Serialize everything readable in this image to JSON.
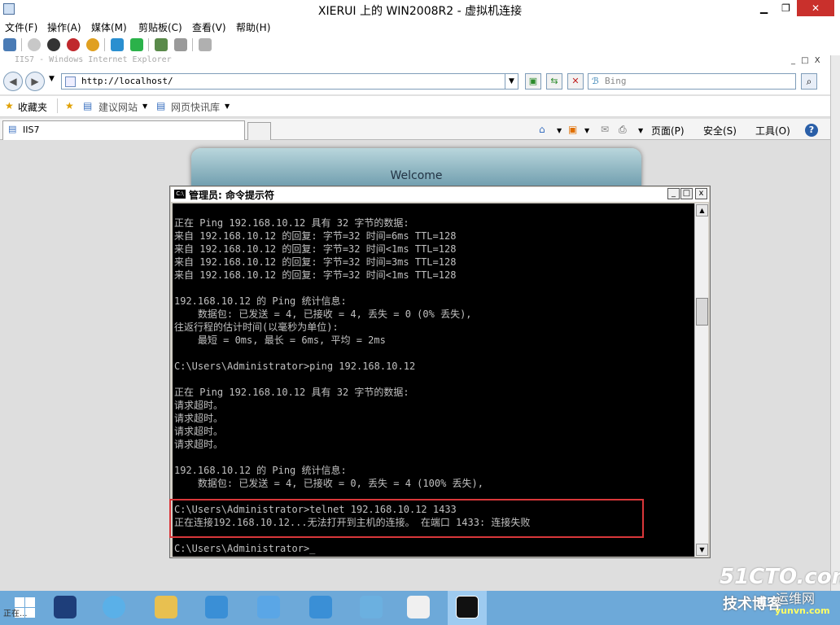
{
  "vm": {
    "title": "XIERUI 上的 WIN2008R2 - 虚拟机连接",
    "minimize": "▁",
    "maximize": "❐",
    "close": "✕",
    "menu": [
      "文件(F)",
      "操作(A)",
      "媒体(M)",
      "剪贴板(C)",
      "查看(V)",
      "帮助(H)"
    ]
  },
  "ie": {
    "title": "IIS7 - Windows Internet Explorer",
    "window_controls": "_ □ X",
    "back": "◀",
    "forward": "▶",
    "address": "http://localhost/",
    "search_placeholder": "Bing",
    "search_go": "⌕",
    "favorites": "收藏夹",
    "suggested_sites": "建议网站",
    "web_slice": "网页快讯库",
    "tab_title": "IIS7",
    "cmd": {
      "page": "页面(P)",
      "safety": "安全(S)",
      "tools": "工具(O)",
      "help": "?"
    },
    "welcome": "Welcome"
  },
  "cmd": {
    "title": "管理员: 命令提示符",
    "icon_text": "C:\\",
    "minimize": "_",
    "maximize": "□",
    "close": "x",
    "lines": [
      "正在 Ping 192.168.10.12 具有 32 字节的数据:",
      "来自 192.168.10.12 的回复: 字节=32 时间=6ms TTL=128",
      "来自 192.168.10.12 的回复: 字节=32 时间<1ms TTL=128",
      "来自 192.168.10.12 的回复: 字节=32 时间=3ms TTL=128",
      "来自 192.168.10.12 的回复: 字节=32 时间<1ms TTL=128",
      "",
      "192.168.10.12 的 Ping 统计信息:",
      "    数据包: 已发送 = 4, 已接收 = 4, 丢失 = 0 (0% 丢失),",
      "往返行程的估计时间(以毫秒为单位):",
      "    最短 = 0ms, 最长 = 6ms, 平均 = 2ms",
      "",
      "C:\\Users\\Administrator>ping 192.168.10.12",
      "",
      "正在 Ping 192.168.10.12 具有 32 字节的数据:",
      "请求超时。",
      "请求超时。",
      "请求超时。",
      "请求超时。",
      "",
      "192.168.10.12 的 Ping 统计信息:",
      "    数据包: 已发送 = 4, 已接收 = 0, 丢失 = 4 (100% 丢失),",
      "",
      "C:\\Users\\Administrator>telnet 192.168.10.12 1433",
      "正在连接192.168.10.12...无法打开到主机的连接。 在端口 1433: 连接失败",
      "",
      "C:\\Users\\Administrator>_"
    ]
  },
  "taskbar": {
    "items": [
      "start",
      "powershell-icon",
      "ie-icon",
      "explorer-icon",
      "app-icon",
      "notepad-icon",
      "network-icon",
      "building-icon",
      "server-manager-icon",
      "cmd-icon"
    ],
    "status_text": "正在..."
  },
  "watermark": {
    "site": "51CTO.com",
    "blog": "技术博客",
    "yunwei": "运维网",
    "url": "yunvn.com"
  },
  "colors": {
    "close_red": "#c9302c",
    "highlight": "#d9373a",
    "taskbar": "#6da9d9"
  }
}
